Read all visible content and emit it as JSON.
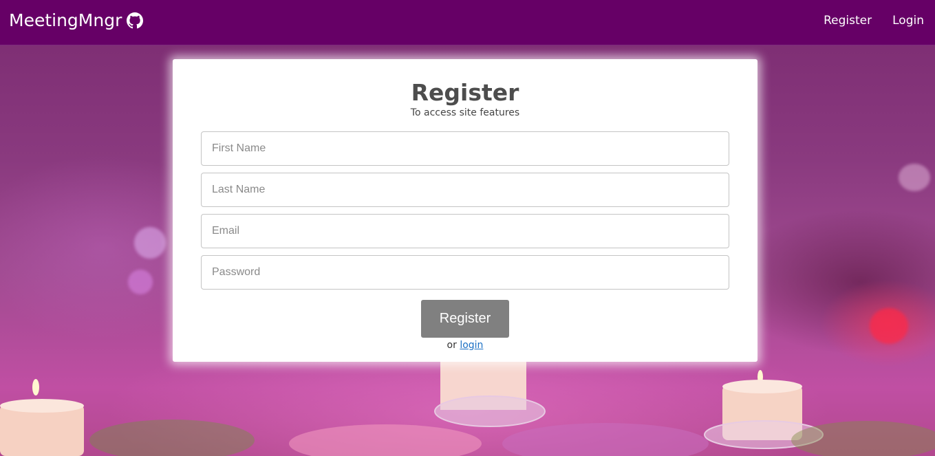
{
  "navbar": {
    "brand": "MeetingMngr",
    "brand_icon": "github-icon",
    "links": [
      "Register",
      "Login"
    ]
  },
  "form": {
    "title": "Register",
    "subtitle": "To access site features",
    "fields": {
      "first_name": {
        "placeholder": "First Name",
        "value": ""
      },
      "last_name": {
        "placeholder": "Last Name",
        "value": ""
      },
      "email": {
        "placeholder": "Email",
        "value": ""
      },
      "password": {
        "placeholder": "Password",
        "value": ""
      }
    },
    "submit_label": "Register",
    "alt_prefix": "or",
    "alt_link": "login"
  },
  "colors": {
    "navbar": "#660066",
    "button": "#808080",
    "link": "#1a6fc4"
  }
}
